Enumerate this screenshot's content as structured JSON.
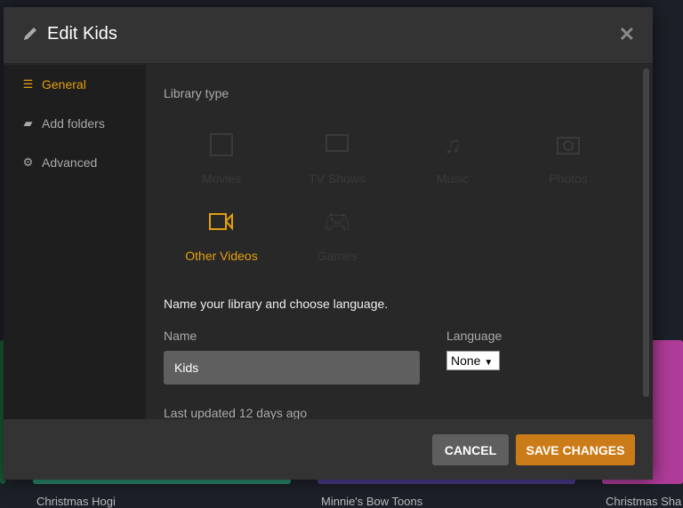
{
  "background": {
    "cards": [
      "Christmas Hogi",
      "Minnie's Bow Toons",
      "Christmas Sha"
    ]
  },
  "modal": {
    "title": "Edit Kids",
    "sidebar": [
      {
        "label": "General",
        "icon": "list-icon"
      },
      {
        "label": "Add folders",
        "icon": "folder-icon"
      },
      {
        "label": "Advanced",
        "icon": "gear-icon"
      }
    ],
    "library_type_label": "Library type",
    "types": [
      {
        "label": "Movies",
        "icon": "film-icon"
      },
      {
        "label": "TV Shows",
        "icon": "tv-icon"
      },
      {
        "label": "Music",
        "icon": "music-icon"
      },
      {
        "label": "Photos",
        "icon": "camera-icon"
      },
      {
        "label": "Other Videos",
        "icon": "video-camera-icon",
        "selected": true
      },
      {
        "label": "Games",
        "icon": "gamepad-icon"
      }
    ],
    "name_heading": "Name your library and choose language.",
    "name_label": "Name",
    "name_value": "Kids",
    "language_label": "Language",
    "language_value": "None",
    "last_updated": "Last updated 12 days ago",
    "cancel": "CANCEL",
    "save": "SAVE CHANGES",
    "colors": {
      "accent": "#e5a00d",
      "save": "#cc7b19"
    }
  }
}
